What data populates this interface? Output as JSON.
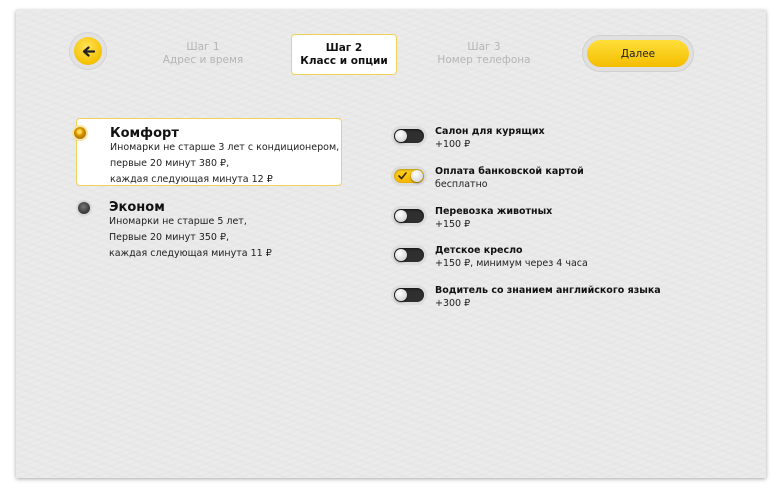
{
  "header": {
    "back_icon": "arrow-left-icon",
    "steps": [
      {
        "label": "Шаг 1",
        "sublabel": "Адрес и время",
        "state": "inactive"
      },
      {
        "label": "Шаг 2",
        "sublabel": "Класс и опции",
        "state": "active"
      },
      {
        "label": "Шаг 3",
        "sublabel": "Номер телефона",
        "state": "inactive"
      }
    ],
    "next_label": "Далее"
  },
  "tariffs": [
    {
      "name": "Комфорт",
      "lines": [
        "Иномарки не старше 3 лет с кондиционером,",
        "первые 20 минут 380 ₽,",
        "каждая следующая минута 12 ₽"
      ],
      "selected": true
    },
    {
      "name": "Эконом",
      "lines": [
        "Иномарки не старше 5 лет,",
        "Первые 20 минут 350 ₽,",
        "каждая следующая минута 11 ₽"
      ],
      "selected": false
    }
  ],
  "options": [
    {
      "title": "Салон для курящих",
      "price": "+100 ₽",
      "enabled": false
    },
    {
      "title": "Оплата банковской картой",
      "price": "бесплатно",
      "enabled": true
    },
    {
      "title": "Перевозка животных",
      "price": "+150 ₽",
      "enabled": false
    },
    {
      "title": "Детское кресло",
      "price": "+150 ₽, минимум через 4 часа",
      "enabled": false
    },
    {
      "title": "Водитель со знанием английского языка",
      "price": "+300 ₽",
      "enabled": false
    }
  ],
  "colors": {
    "accent": "#f5c200",
    "background": "#ebebeb",
    "selected_border": "#f0d25a"
  }
}
